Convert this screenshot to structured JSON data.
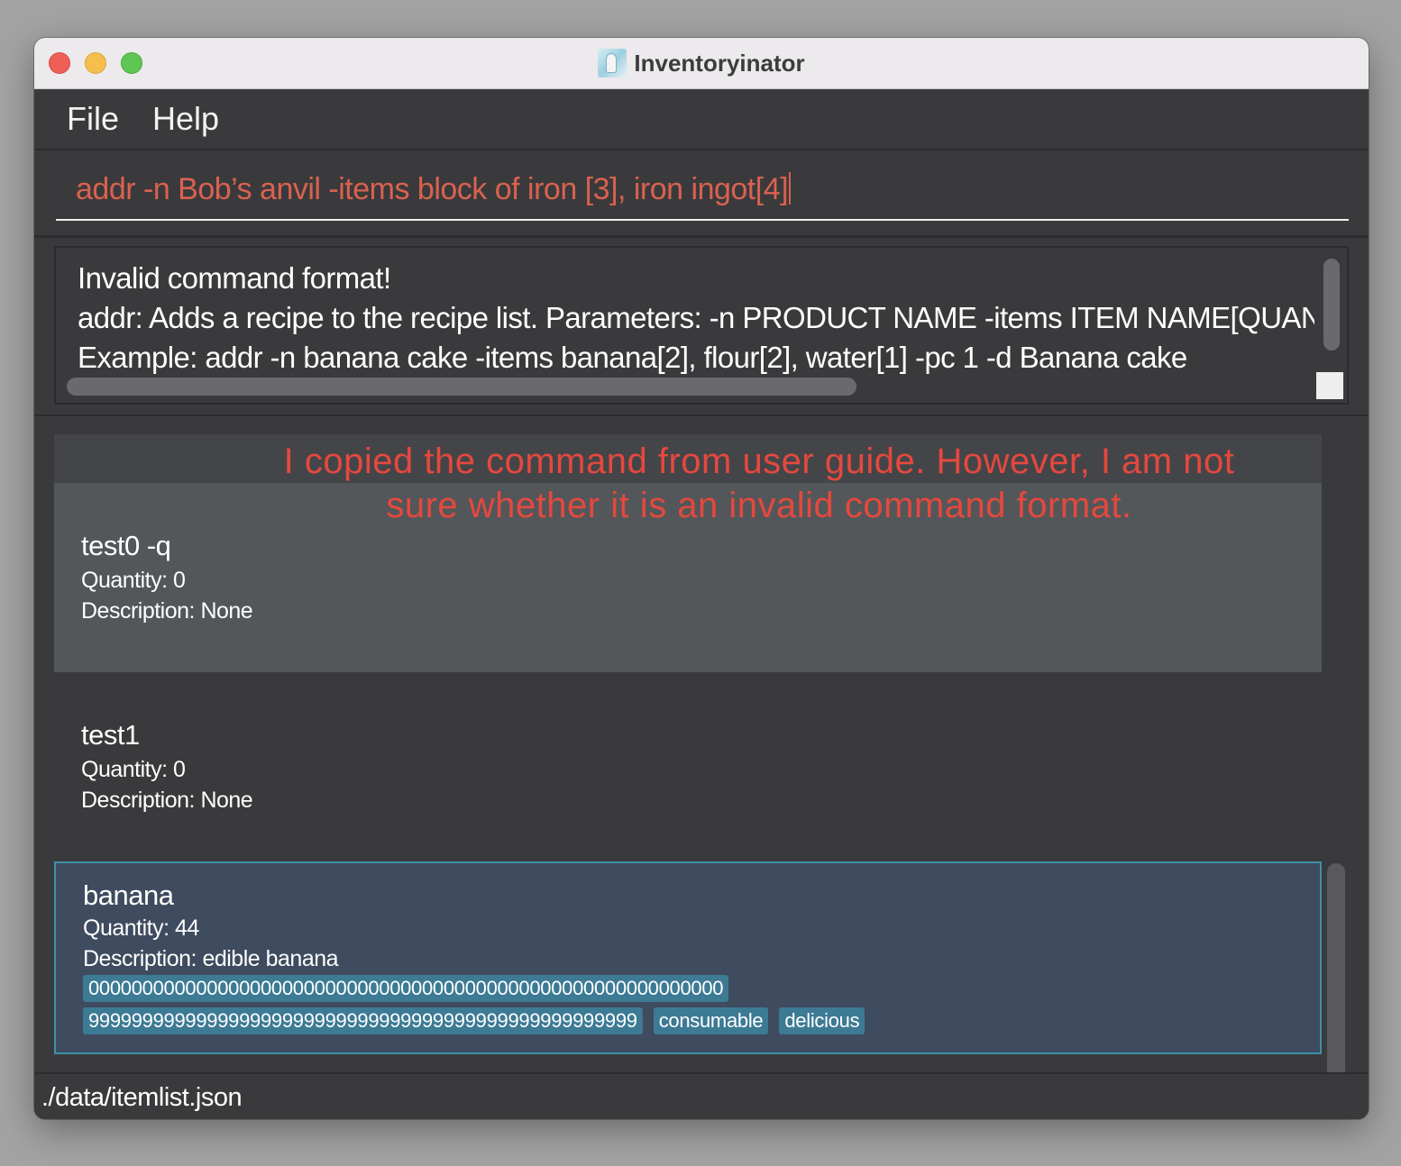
{
  "window": {
    "title": "Inventoryinator",
    "app_icon": "inventoryinator-app-icon"
  },
  "menu": {
    "file": "File",
    "help": "Help"
  },
  "command": {
    "value": "addr -n Bob’s anvil -items block of iron [3], iron ingot[4]"
  },
  "result": {
    "lines": [
      "Invalid command format!",
      "addr: Adds a recipe to the recipe list. Parameters: -n PRODUCT NAME -items ITEM NAME[QUANTITY]",
      "Example: addr -n banana cake -items banana[2], flour[2], water[1] -pc 1 -d Banana cake"
    ]
  },
  "annotation": {
    "line1": "I copied the command from user guide. However, I am not",
    "line2": "sure whether it is an invalid command format.",
    "color": "#e5483e"
  },
  "items": [
    {
      "name": "test0 -q",
      "quantity": "Quantity: 0",
      "description": "Description: None",
      "tags": []
    },
    {
      "name": "test1",
      "quantity": "Quantity: 0",
      "description": "Description: None",
      "tags": []
    },
    {
      "name": "banana",
      "quantity": "Quantity: 44",
      "description": "Description: edible banana",
      "tags": [
        "00000000000000000000000000000000000000000000000000000000000",
        "999999999999999999999999999999999999999999999999999",
        "consumable",
        "delicious"
      ],
      "selected": true
    }
  ],
  "status": {
    "path": "./data/itemlist.json"
  },
  "colors": {
    "command_text": "#d9624f",
    "tag_bg": "#3d7a94",
    "selected_border": "#3e90a8"
  }
}
